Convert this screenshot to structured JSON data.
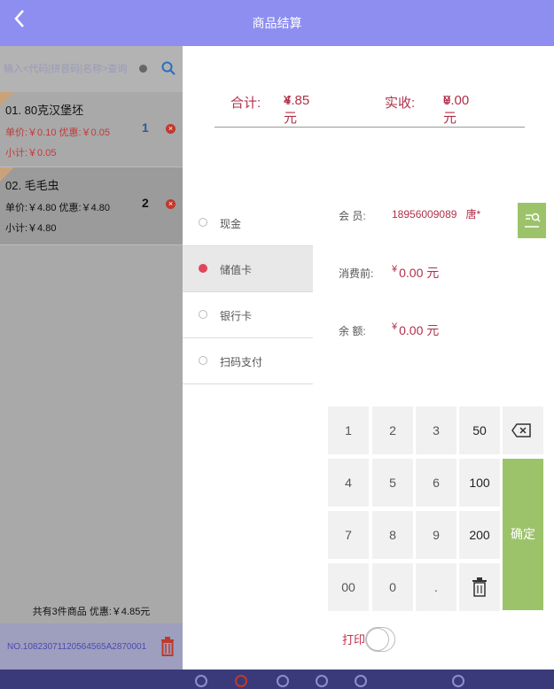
{
  "header": {
    "title": "商品结算",
    "back_icon": "chevron-left-icon"
  },
  "search": {
    "placeholder": "输入<代码|拼音码|名称>查询..."
  },
  "items": [
    {
      "name": "01. 80克汉堡坯",
      "price_line": "单价:￥0.10  优惠:￥0.05",
      "subtotal": "小计:￥0.05",
      "qty": "1"
    },
    {
      "name": "02. 毛毛虫",
      "price_line": "单价:￥4.80  优惠:￥4.80",
      "subtotal": "小计:￥4.80",
      "qty": "2"
    }
  ],
  "summary": "共有3件商品  优惠:￥4.85元",
  "order_no": "NO.10823071120564565A2870001",
  "totals": {
    "total_label": "合计:",
    "total_value": "4.85 元",
    "received_label": "实收:",
    "received_value": "0.00 元",
    "currency": "¥"
  },
  "payment_methods": [
    {
      "label": "现金",
      "active": false
    },
    {
      "label": "储值卡",
      "active": true
    },
    {
      "label": "银行卡",
      "active": false
    },
    {
      "label": "扫码支付",
      "active": false
    }
  ],
  "member": {
    "member_label": "会 员:",
    "member_phone": "18956009089",
    "member_name": "唐*",
    "before_label": "消费前:",
    "before_value": "0.00 元",
    "balance_label": "余 额:",
    "balance_value": "0.00 元"
  },
  "keypad": {
    "keys": [
      "1",
      "2",
      "3",
      "50",
      "4",
      "5",
      "6",
      "100",
      "7",
      "8",
      "9",
      "200",
      "00",
      "0",
      "."
    ],
    "confirm": "确定"
  },
  "print_label": "打印",
  "colors": {
    "header": "#8d8ef0",
    "accent": "#b0304a",
    "confirm": "#9cc36a"
  }
}
